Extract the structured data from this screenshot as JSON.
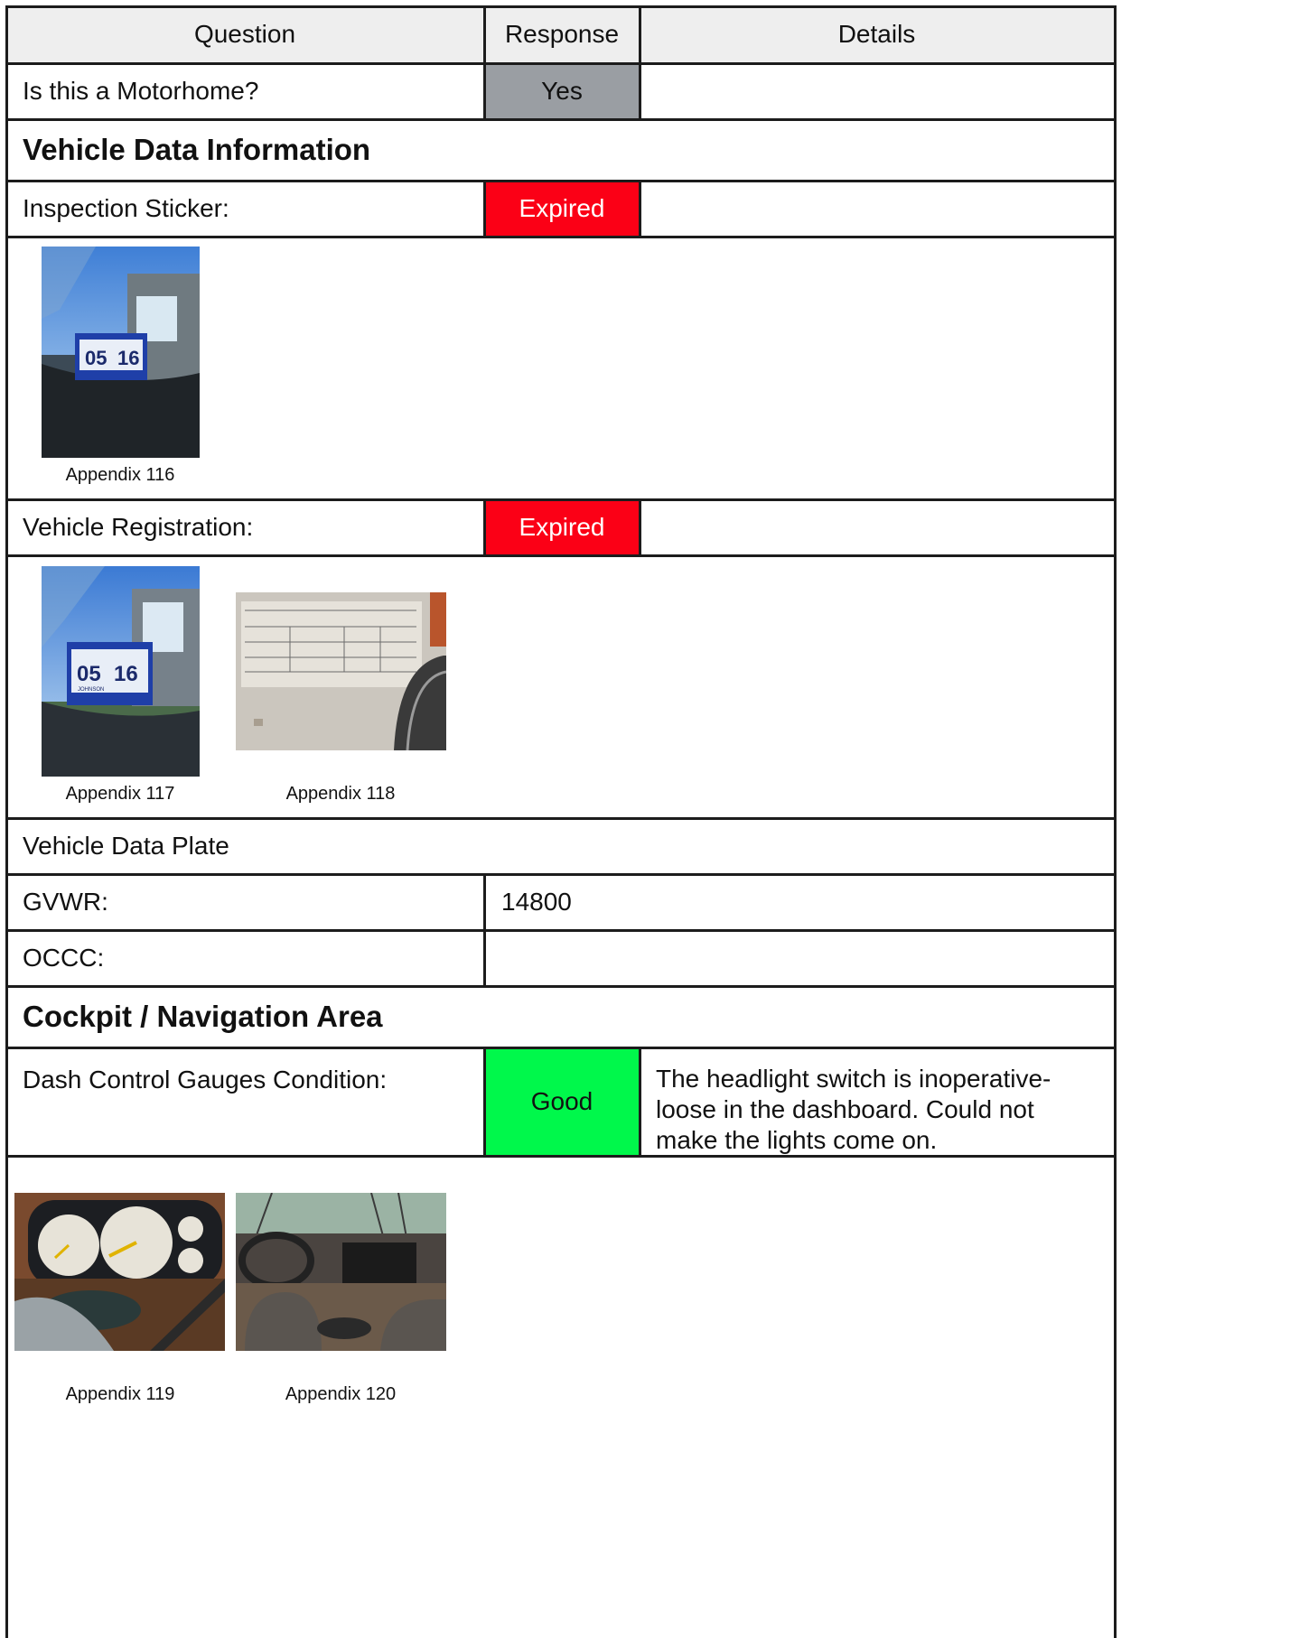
{
  "header": {
    "question": "Question",
    "response": "Response",
    "details": "Details"
  },
  "rows": {
    "motorhome": {
      "question": "Is this a Motorhome?",
      "response": "Yes",
      "details": ""
    },
    "section_vehicle": {
      "title": "Vehicle Data Information"
    },
    "inspection": {
      "question": "Inspection Sticker:",
      "response": "Expired",
      "details": ""
    },
    "registration": {
      "question": "Vehicle Registration:",
      "response": "Expired",
      "details": ""
    },
    "data_plate": {
      "title": "Vehicle Data Plate"
    },
    "gvwr": {
      "question": "GVWR:",
      "value": "14800"
    },
    "occc": {
      "question": "OCCC:",
      "value": ""
    },
    "section_cockpit": {
      "title": "Cockpit / Navigation Area"
    },
    "dash": {
      "question": "Dash Control Gauges Condition:",
      "response": "Good",
      "details": "The headlight switch is inoperative- loose in the dashboard. Could not make the lights come on."
    }
  },
  "sticker_text": {
    "left": "05",
    "right": "16",
    "owner": "JOHNSON"
  },
  "appendices": {
    "a116": "Appendix 116",
    "a117": "Appendix 117",
    "a118": "Appendix 118",
    "a119": "Appendix 119",
    "a120": "Appendix 120"
  },
  "colors": {
    "expired": "#fb0016",
    "good": "#00f84b",
    "yes": "#9a9ea3",
    "header": "#eeeeee"
  }
}
